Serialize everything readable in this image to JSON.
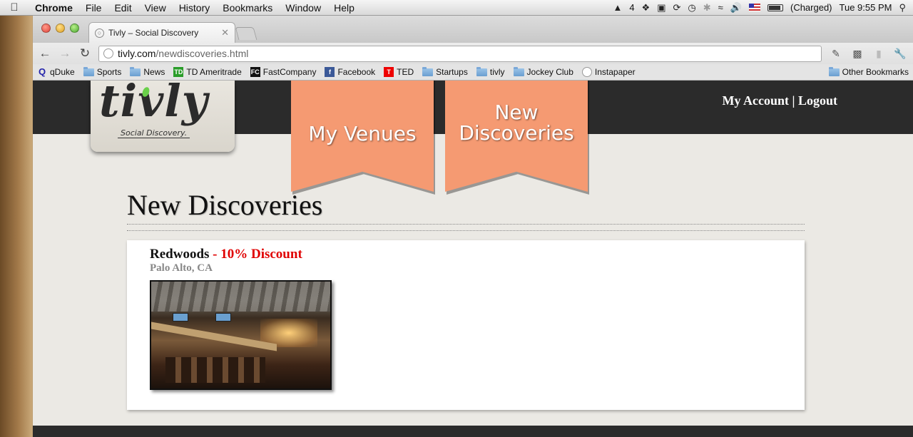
{
  "menubar": {
    "app": "Chrome",
    "items": [
      "File",
      "Edit",
      "View",
      "History",
      "Bookmarks",
      "Window",
      "Help"
    ],
    "status_count": "4",
    "battery": "(Charged)",
    "clock": "Tue 9:55 PM"
  },
  "browser": {
    "tab_title": "Tivly – Social Discovery",
    "url_host": "tivly.com",
    "url_path": "/newdiscoveries.html",
    "bookmarks": [
      {
        "label": "qDuke",
        "icon": "q-icon"
      },
      {
        "label": "Sports",
        "icon": "folder-icon"
      },
      {
        "label": "News",
        "icon": "folder-icon"
      },
      {
        "label": "TD Ameritrade",
        "icon": "td-icon"
      },
      {
        "label": "FastCompany",
        "icon": "fc-icon"
      },
      {
        "label": "Facebook",
        "icon": "facebook-icon"
      },
      {
        "label": "TED",
        "icon": "ted-icon"
      },
      {
        "label": "Startups",
        "icon": "folder-icon"
      },
      {
        "label": "tivly",
        "icon": "folder-icon"
      },
      {
        "label": "Jockey Club",
        "icon": "folder-icon"
      },
      {
        "label": "Instapaper",
        "icon": "globe-icon"
      }
    ],
    "other_bookmarks": "Other Bookmarks"
  },
  "site": {
    "logo_text": "tivly",
    "logo_tagline": "Social Discovery.",
    "nav": [
      {
        "label_line1": "My Venues",
        "label_line2": ""
      },
      {
        "label_line1": "New",
        "label_line2": "Discoveries"
      }
    ],
    "account_link": "My Account",
    "account_sep": " | ",
    "logout_link": "Logout",
    "page_title": "New Discoveries",
    "venue": {
      "name": "Redwoods",
      "discount": " - 10% Discount",
      "location": "Palo Alto, CA"
    }
  },
  "colors": {
    "ribbon": "#f59a72",
    "header": "#2b2b2b",
    "discount": "#e00000",
    "accent_green": "#6ad04a"
  }
}
